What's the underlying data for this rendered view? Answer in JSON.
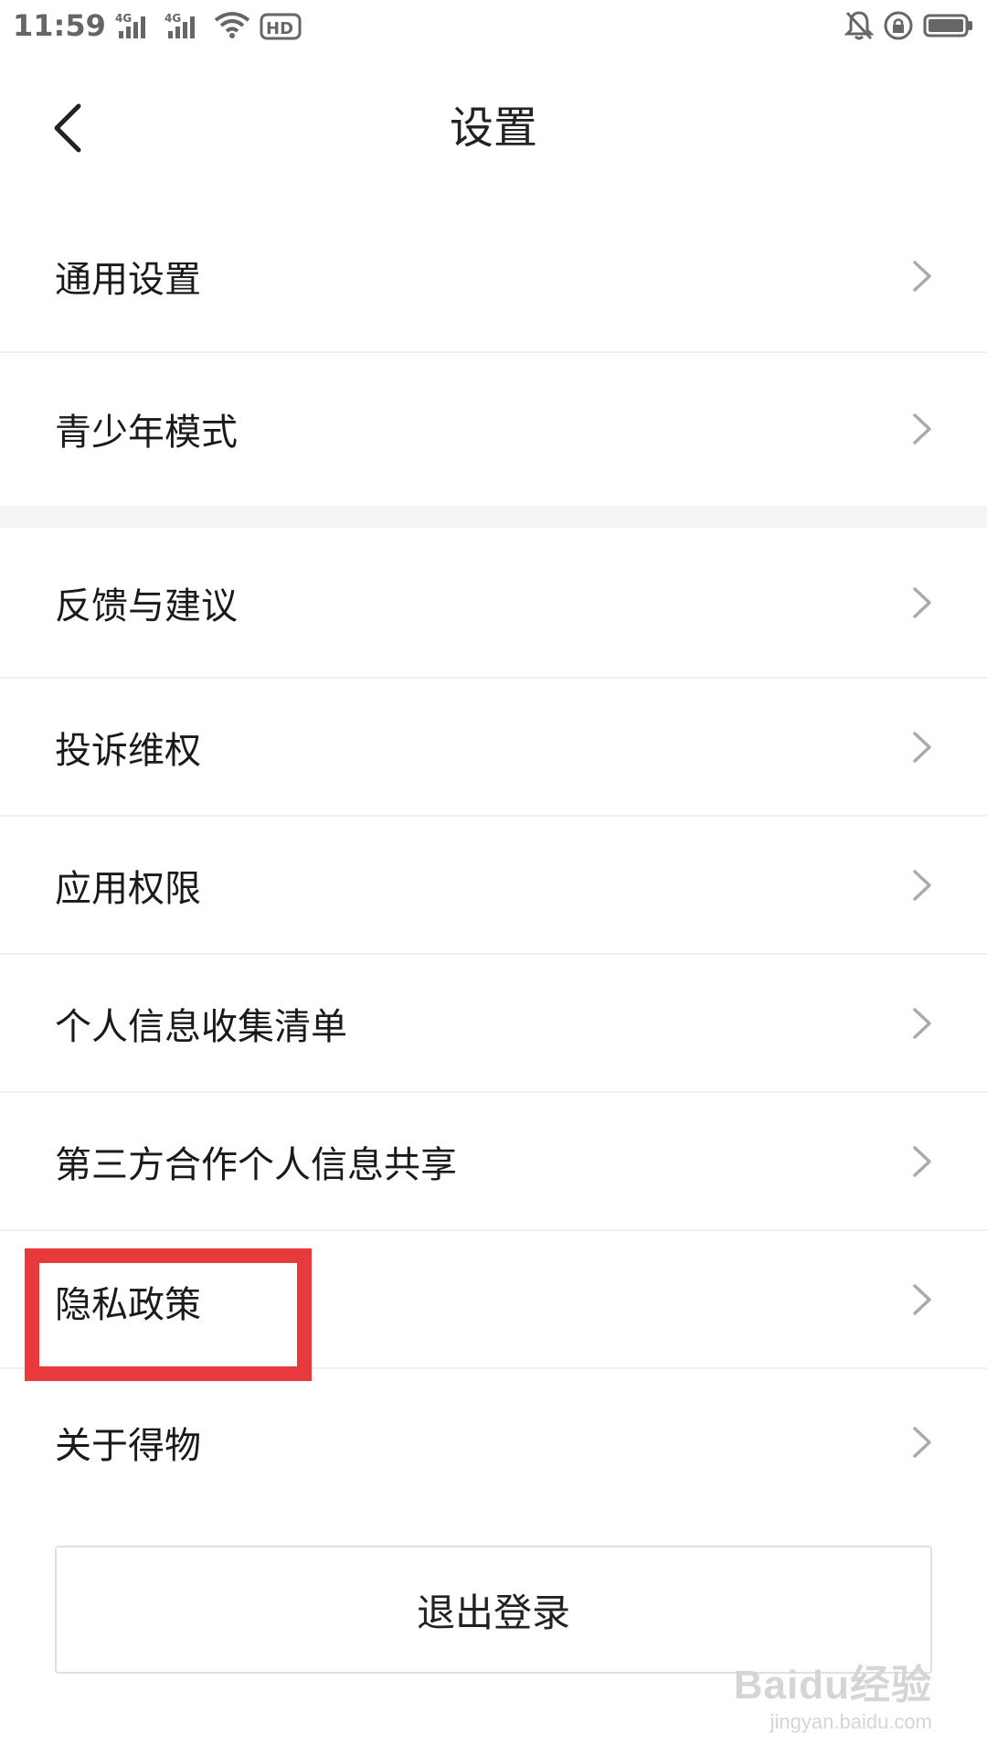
{
  "status_bar": {
    "time": "11:59",
    "signal1_label": "4G",
    "signal2_label": "4G",
    "hd_label": "HD",
    "battery_color": "#666666"
  },
  "header": {
    "title": "设置",
    "back_icon": "chevron-left-icon"
  },
  "settings_group_1": [
    {
      "label": "通用设置"
    },
    {
      "label": "青少年模式"
    }
  ],
  "settings_group_2": [
    {
      "label": "反馈与建议"
    },
    {
      "label": "投诉维权"
    },
    {
      "label": "应用权限"
    },
    {
      "label": "个人信息收集清单"
    },
    {
      "label": "第三方合作个人信息共享"
    },
    {
      "label": "隐私政策"
    },
    {
      "label": "关于得物"
    }
  ],
  "logout_label": "退出登录",
  "annotation": {
    "highlight_color": "#e8393c",
    "highlighted_item": "隐私政策"
  },
  "watermark": {
    "main": "Baidu经验",
    "sub": "jingyan.baidu.com"
  }
}
